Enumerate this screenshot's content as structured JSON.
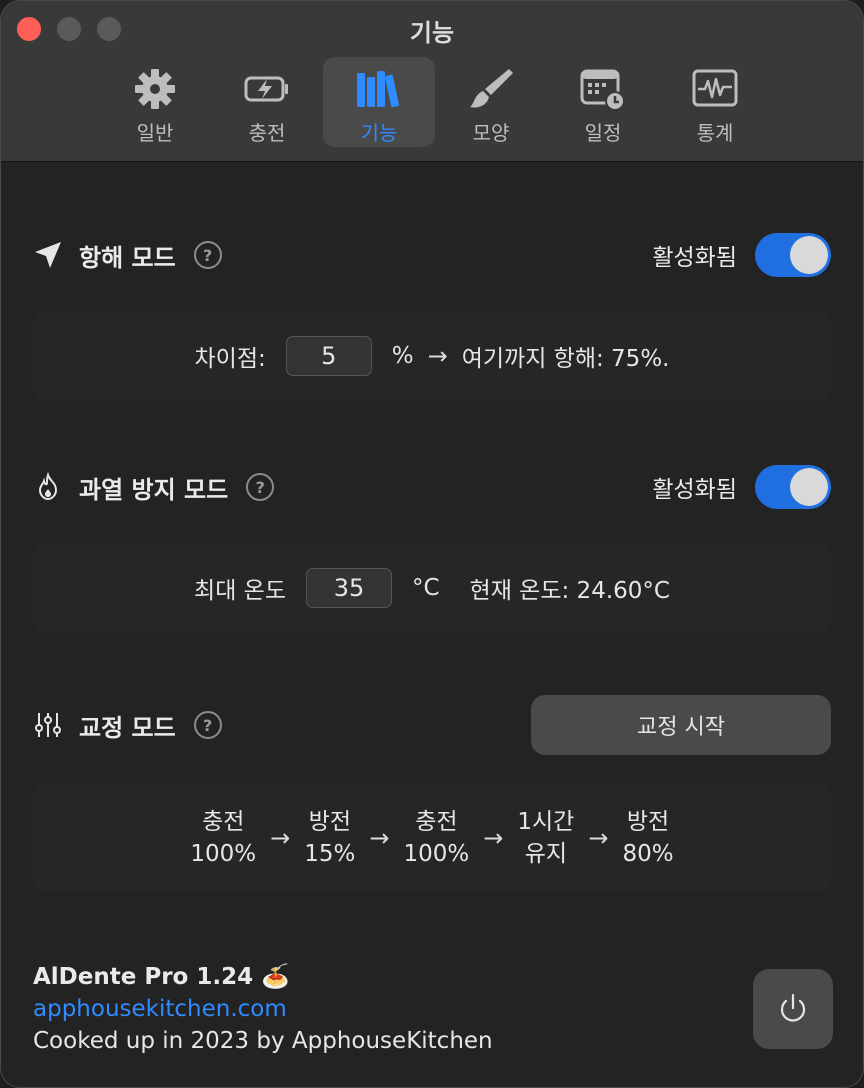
{
  "window": {
    "title": "기능"
  },
  "tabs": [
    {
      "label": "일반",
      "icon": "gear-icon"
    },
    {
      "label": "충전",
      "icon": "battery-charging-icon"
    },
    {
      "label": "기능",
      "icon": "books-icon",
      "active": true
    },
    {
      "label": "모양",
      "icon": "paintbrush-icon"
    },
    {
      "label": "일정",
      "icon": "calendar-clock-icon"
    },
    {
      "label": "통계",
      "icon": "waveform-icon"
    }
  ],
  "sailing": {
    "title": "항해 모드",
    "help": "?",
    "status": "활성화됨",
    "enabled": true,
    "diff_label": "차이점:",
    "diff_value": "5",
    "unit": "%",
    "arrow": "→",
    "target_text": "여기까지 항해: 75%."
  },
  "heat": {
    "title": "과열 방지 모드",
    "help": "?",
    "status": "활성화됨",
    "enabled": true,
    "max_label": "최대 온도",
    "max_value": "35",
    "unit": "°C",
    "current_text": "현재 온도: 24.60°C"
  },
  "calibration": {
    "title": "교정 모드",
    "help": "?",
    "button": "교정 시작",
    "steps": [
      {
        "line1": "충전",
        "line2": "100%"
      },
      {
        "line1": "방전",
        "line2": "15%"
      },
      {
        "line1": "충전",
        "line2": "100%"
      },
      {
        "line1": "1시간",
        "line2": "유지"
      },
      {
        "line1": "방전",
        "line2": "80%"
      }
    ],
    "arrow": "→"
  },
  "footer": {
    "app_name": "AlDente Pro 1.24 🍝",
    "link": "apphousekitchen.com",
    "credit": "Cooked up in 2023 by ApphouseKitchen"
  },
  "colors": {
    "accent": "#2f8bff",
    "toggle_on": "#1f6fe0",
    "close": "#fe5f57"
  }
}
